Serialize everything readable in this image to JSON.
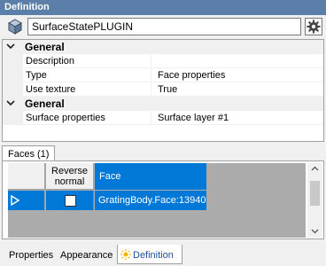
{
  "window": {
    "title": "Definition"
  },
  "name_field": {
    "value": "SurfaceStatePLUGIN"
  },
  "icons": {
    "object": "cube-icon",
    "settings": "gear-icon",
    "collapse": "chevron-down-icon",
    "row_pointer": "triangle-right-icon",
    "definition_tab": "sun-icon"
  },
  "property_grid": {
    "categories": [
      {
        "label": "General",
        "properties": [
          {
            "name": "Description",
            "value": ""
          },
          {
            "name": "Type",
            "value": "Face properties"
          },
          {
            "name": "Use texture",
            "value": "True"
          }
        ]
      },
      {
        "label": "General",
        "properties": [
          {
            "name": "Surface properties",
            "value": "Surface layer #1"
          }
        ]
      }
    ]
  },
  "faces_panel": {
    "tab_label": "Faces (1)",
    "columns": [
      "Reverse normal",
      "Face"
    ],
    "rows": [
      {
        "reverse_normal": false,
        "face": "GratingBody.Face:13940"
      }
    ]
  },
  "bottom_tabs": [
    {
      "label": "Properties",
      "active": false
    },
    {
      "label": "Appearance",
      "active": false
    },
    {
      "label": "Definition",
      "active": true
    }
  ],
  "colors": {
    "title_bar": "#5b7fa8",
    "selection": "#0078d7",
    "active_tab_text": "#1f4e9c",
    "sun_icon": "#f4b400"
  }
}
